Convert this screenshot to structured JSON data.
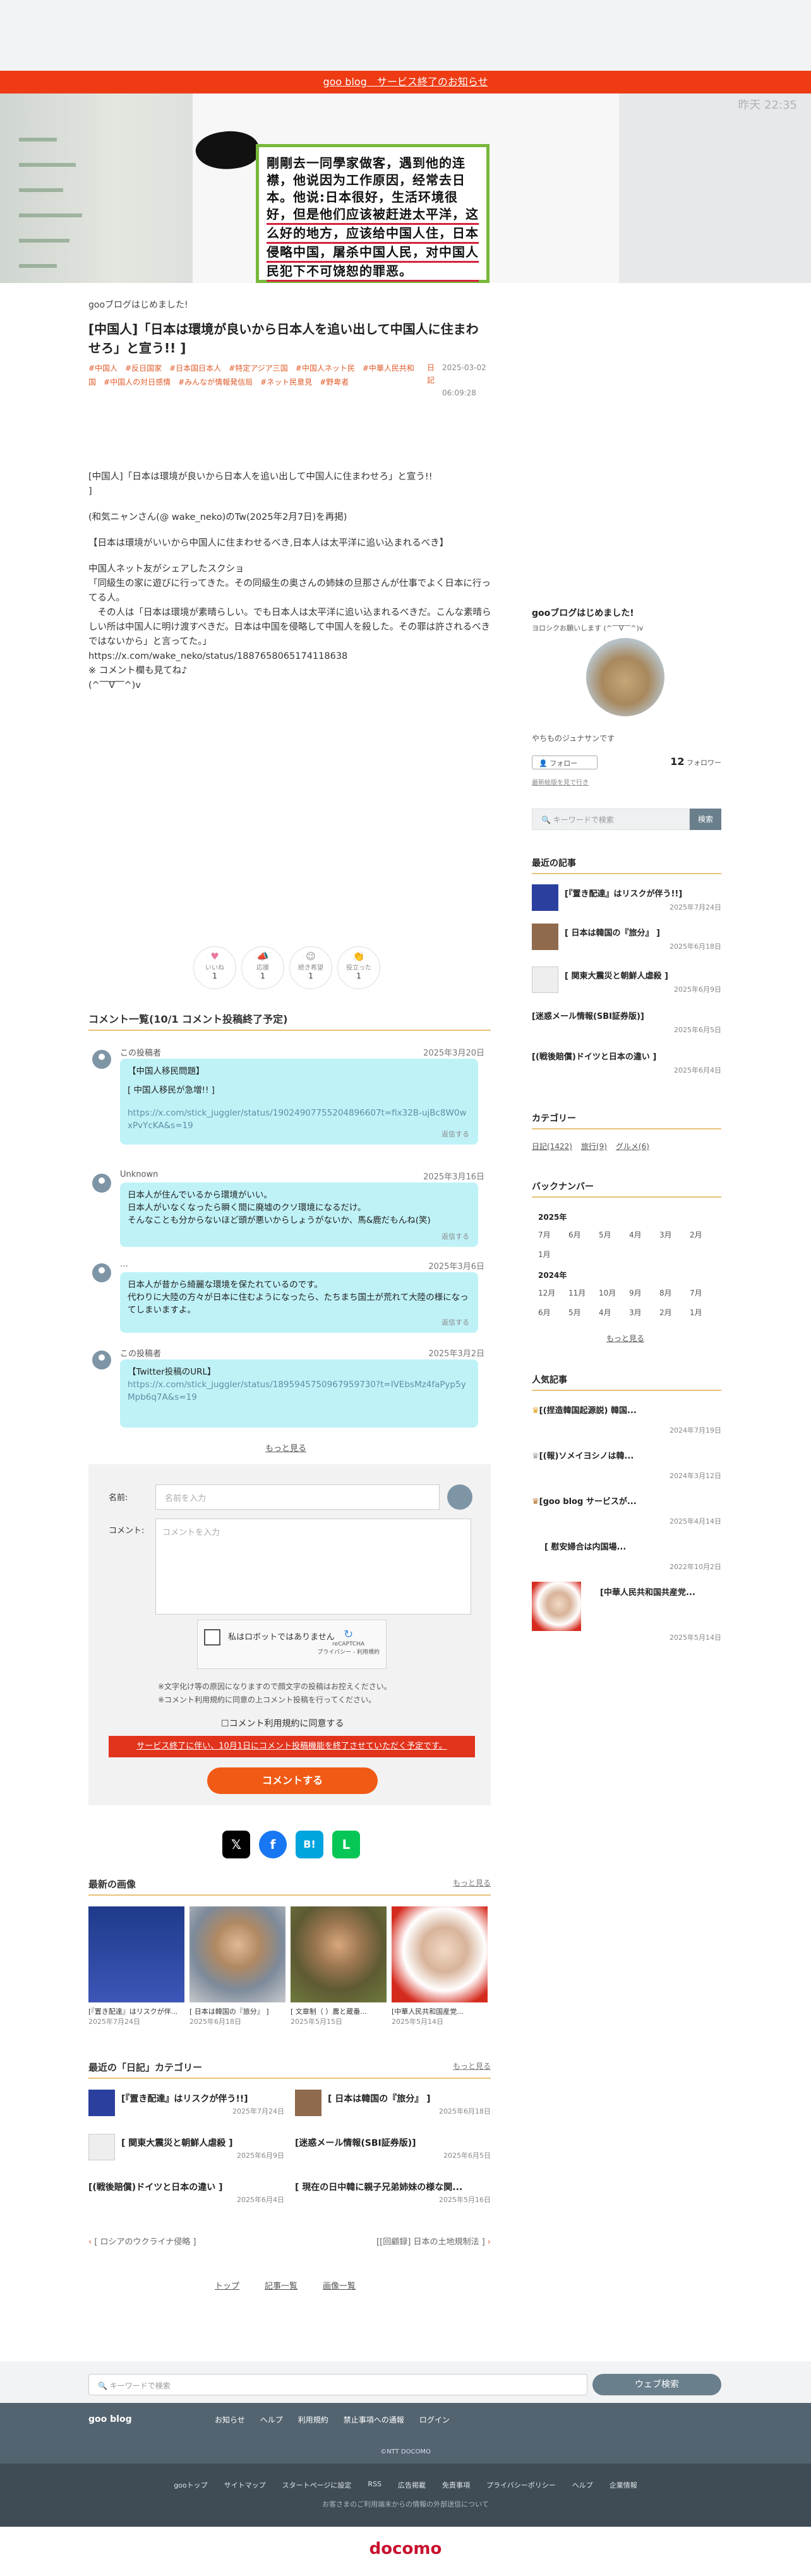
{
  "announce": "goo blog　サービス終了のお知らせ",
  "hero": {
    "time": "昨天 22:35",
    "card_lines": [
      "剛剛去一同學家做客，遇到他的连",
      "襟，他说因为工作原因，经常去日",
      "本。他说:日本很好，生活环境很",
      "好，但是他们应该被赶进太平洋，这",
      "么好的地方，应该给中国人住，日本",
      "侵略中国，屠杀中国人民，对中国人",
      "民犯下不可饶恕的罪恶。"
    ]
  },
  "breadcrumb": "gooブログはじめました!",
  "title": "[中国人]「日本は環境が良いから日本人を追い出して中国人に住まわせろ」と宣う!!  ]",
  "tags": [
    "#中国人",
    "#反日国家",
    "#日本国日本人",
    "#特定アジア三国",
    "#中国人ネット民",
    "#中華人民共和国",
    "#中国人の対日感情",
    "#みんなが情報発信局",
    "#ネット民意見",
    "#野卑者"
  ],
  "meta": {
    "k1": "日",
    "k2": "記",
    "date": "2025-03-02",
    "time": "06:09:28"
  },
  "body": [
    "[中国人]「日本は環境が良いから日本人を追い出して中国人に住まわせろ」と宣う!!\n]",
    "(和気ニャンさん(@ wake_neko)のTw(2025年2月7日)を再掲)",
    "【日本は環境がいいから中国人に住まわせるべき,日本人は太平洋に追い込まれるべき】",
    "中国人ネット友がシェアしたスクショ\n「同級生の家に遊びに行ってきた。その同級生の奥さんの姉妹の旦那さんが仕事でよく日本に行ってる人。\n　その人は「日本は環境が素晴らしい。でも日本人は太平洋に追い込まれるべきだ。こんな素晴らしい所は中国人に明け渡すべきだ。日本は中国を侵略して中国人を殺した。その罪は許されるべきではないから」と言ってた。」\nhttps://x.com/wake_neko/status/1887658065174118638\n※ コメント欄も見てね♪\n(^‾‾∇‾‾^)v"
  ],
  "reactions": [
    {
      "label": "いいね",
      "count": "1",
      "icon": "heart-icon",
      "glyph": "♥"
    },
    {
      "label": "応援",
      "count": "1",
      "icon": "cheer-icon",
      "glyph": "📣"
    },
    {
      "label": "続き希望",
      "count": "1",
      "icon": "wink-icon",
      "glyph": "😉"
    },
    {
      "label": "役立った",
      "count": "1",
      "icon": "clap-icon",
      "glyph": "👏"
    }
  ],
  "comments_head": "コメント一覧(10/1 コメント投稿終了予定)",
  "comments": [
    {
      "name": "この投稿者",
      "date": "2025年3月20日",
      "lines": [
        "【中国人移民問題】",
        "",
        "[ 中国人移民が急増!! ]",
        "",
        ""
      ],
      "link": "https://x.com/stick_juggler/status/19024907755204896607t=fix32B-ujBc8W0wxPvYcKA&s=19",
      "reply": "返信する"
    },
    {
      "name": "Unknown",
      "date": "2025年3月16日",
      "lines": [
        "日本人が住んでいるから環境がいい。",
        "日本人がいなくなったら瞬く間に廃墟のクソ環境になるだけ。",
        "そんなことも分からないほど頭が悪いからしょうがないか、馬&鹿だもんね(笑)"
      ],
      "link": "",
      "reply": "返信する"
    },
    {
      "name": "…",
      "date": "2025年3月6日",
      "lines": [
        "日本人が昔から綺麗な環境を保たれているのです。",
        "代わりに大陸の方々が日本に住むようになったら、たちまち国土が荒れて大陸の様になってしまいますよ。"
      ],
      "link": "",
      "reply": "返信する"
    },
    {
      "name": "この投稿者",
      "date": "2025年3月2日",
      "lines": [
        "【Twitter投稿のURL】"
      ],
      "link": "https://x.com/stick_juggler/status/1895945750967959730?t=IVEbsMz4faPyp5yMpb6q7A&s=19",
      "reply": "返信する"
    }
  ],
  "more_comments": "もっと見る",
  "form": {
    "name_label": "名前:",
    "name_placeholder": "名前を入力",
    "comment_label": "コメント:",
    "comment_placeholder": "コメントを入力",
    "recaptcha_text": "私はロボットではありません",
    "recaptcha_logo": "reCAPTCHA",
    "recaptcha_small": "プライバシー - 利用規約",
    "note1": "※文字化け等の原因になりますので顔文字の投稿はお控えください。",
    "note2": "※コメント利用規約に同意の上コメント投稿を行ってください。",
    "agree": "コメント利用規約に同意する",
    "warning": "サービス終了に伴い、10月1日にコメント投稿機能を終了させていただく予定です。",
    "submit": "コメントする"
  },
  "share": [
    {
      "name": "x-share",
      "glyph": "𝕏",
      "color": "#000000"
    },
    {
      "name": "facebook-share",
      "glyph": "f",
      "color": "#1877f2"
    },
    {
      "name": "hatena-share",
      "glyph": "B!",
      "color": "#00a4de"
    },
    {
      "name": "line-share",
      "glyph": "L",
      "color": "#06c755"
    }
  ],
  "latest_images": {
    "title": "最新の画像",
    "more": "もっと見る",
    "items": [
      {
        "cap": "[『置き配達』はリスクが伴...",
        "date": "2025年7月24日",
        "color": "#2b3f9e"
      },
      {
        "cap": "[ 日本は韓国の『旅分』 ]",
        "date": "2025年6月18日",
        "color": "#8f6a4c"
      },
      {
        "cap": "[ 文章制（ ）農と蔵番...",
        "date": "2025年5月15日",
        "color": "#6f6a3e"
      },
      {
        "cap": "[中華人民共和国産党...",
        "date": "2025年5月14日",
        "color": "#d8b39a"
      }
    ]
  },
  "diary": {
    "title": "最近の「日記」カテゴリー",
    "more": "もっと見る",
    "items": [
      {
        "t": "[『置き配達』はリスクが伴う!!]",
        "d": "2025年7月24日"
      },
      {
        "t": "[ 日本は韓国の『旅分』 ]",
        "d": "2025年6月18日"
      },
      {
        "t": "[ 関東大震災と朝鮮人虐殺 ]",
        "d": "2025年6月9日"
      },
      {
        "t": "[迷惑メール情報(SBI証券版)]",
        "d": "2025年6月5日"
      },
      {
        "t": "[(戦後賠償)ドイツと日本の違い ]",
        "d": "2025年6月4日"
      },
      {
        "t": "[ 現在の日中韓に親子兄弟姉妹の様な関...",
        "d": "2025年5月16日"
      }
    ]
  },
  "pager": {
    "prev": "[ ロシアのウクライナ侵略 ]",
    "next": "[[回顧録] 日本の土地規制法 ]"
  },
  "bottom_links": [
    "トップ",
    "記事一覧",
    "画像一覧"
  ],
  "sidebar": {
    "blog_name": "gooブログはじめました!",
    "blog_sub": "ヨロシクお願いします (^‾‾∇‾‾^)v",
    "user": "やちものジュナサンです",
    "follow": "フォロー",
    "follower_count": "12",
    "follower_label": "フォロワー",
    "block_note": "最新絵版を見で行き",
    "search_placeholder": "キーワードで検索",
    "search_btn": "検索",
    "recent_title": "最近の記事",
    "recent": [
      {
        "t": "[『置き配達』はリスクが伴う!!]",
        "d": "2025年7月24日"
      },
      {
        "t": "[ 日本は韓国の『旅分』 ]",
        "d": "2025年6月18日"
      },
      {
        "t": "[ 関東大震災と朝鮮人虐殺 ]",
        "d": "2025年6月9日"
      },
      {
        "t": "[迷惑メール情報(SBI証券版)]",
        "d": "2025年6月5日"
      },
      {
        "t": "[(戦後賠償)ドイツと日本の違い ]",
        "d": "2025年6月4日"
      }
    ],
    "cat_title": "カテゴリー",
    "cats": [
      "日記(1422)",
      "旅行(9)",
      "グルメ(6)"
    ],
    "back_title": "バックナンバー",
    "y1": "2025年",
    "m1": [
      "7月",
      "6月",
      "5月",
      "4月",
      "3月",
      "2月",
      "1月"
    ],
    "y2": "2024年",
    "m2": [
      "12月",
      "11月",
      "10月",
      "9月",
      "8月",
      "7月",
      "6月",
      "5月",
      "4月",
      "3月",
      "2月",
      "1月"
    ],
    "more": "もっと見る",
    "pop_title": "人気記事",
    "pop": [
      {
        "t": "[(捏造韓国起源説) 韓国...",
        "d": "2024年7月19日"
      },
      {
        "t": "[(報)ソメイヨシノは韓...",
        "d": "2024年3月12日"
      },
      {
        "t": "[goo blog サービスが...",
        "d": "2025年4月14日"
      },
      {
        "t": "[ 慰安婦合は内国場...",
        "d": "2022年10月2日"
      },
      {
        "t": "[中華人民共和国共産党...",
        "d": "2025年5月14日"
      }
    ]
  },
  "footer": {
    "search_placeholder": "キーワードで検索",
    "search_btn": "ウェブ検索",
    "brand": "goo blog",
    "links": [
      "お知らせ",
      "ヘルプ",
      "利用規約",
      "禁止事項への通報",
      "ログイン"
    ],
    "copyright": "©NTT DOCOMO",
    "bottom": [
      "gooトップ",
      "サイトマップ",
      "スタートページに設定",
      "RSS",
      "広告掲載",
      "免責事項",
      "プライバシーポリシー",
      "ヘルプ",
      "企業情報"
    ],
    "notice": "お客さまのご利用端末からの情報の外部送信について",
    "docomo": "docomo"
  }
}
